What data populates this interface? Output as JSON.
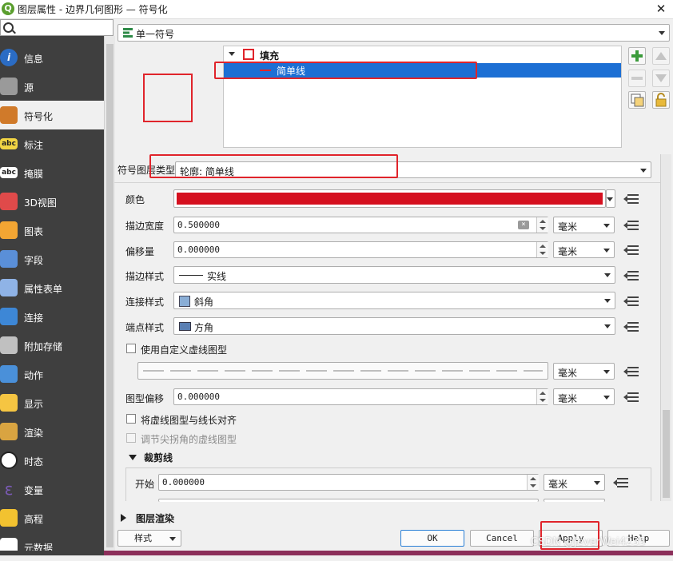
{
  "window": {
    "title": "图层属性 - 边界几何图形 — 符号化",
    "logo_letter": "Q",
    "close": "✕"
  },
  "sidebar": {
    "search_placeholder": "",
    "items": [
      {
        "label": "信息",
        "icon": "info-icon",
        "color": "#2b6cc4"
      },
      {
        "label": "源",
        "icon": "source-gear-icon",
        "color": "#9a9a9a"
      },
      {
        "label": "符号化",
        "icon": "paintbrush-icon",
        "color": "#d07a2a"
      },
      {
        "label": "标注",
        "icon": "label-abc-icon",
        "color": "#f2d544"
      },
      {
        "label": "掩膜",
        "icon": "mask-abc-icon",
        "color": "#ffffff"
      },
      {
        "label": "3D视图",
        "icon": "cube-3d-icon",
        "color": "#e04a4a"
      },
      {
        "label": "图表",
        "icon": "diagram-bars-icon",
        "color": "#f2a533"
      },
      {
        "label": "字段",
        "icon": "fields-icon",
        "color": "#5a8fd8"
      },
      {
        "label": "属性表单",
        "icon": "attribute-form-icon",
        "color": "#8fb3e6"
      },
      {
        "label": "连接",
        "icon": "join-icon",
        "color": "#3d87d6"
      },
      {
        "label": "附加存储",
        "icon": "storage-icon",
        "color": "#c0c0c0"
      },
      {
        "label": "动作",
        "icon": "action-gear-icon",
        "color": "#4a90d9"
      },
      {
        "label": "显示",
        "icon": "display-bubble-icon",
        "color": "#f5c542"
      },
      {
        "label": "渲染",
        "icon": "rendering-brush-icon",
        "color": "#d9a441"
      },
      {
        "label": "时态",
        "icon": "clock-icon",
        "color": "#ffffff"
      },
      {
        "label": "变量",
        "icon": "variable-epsilon-icon",
        "color": "#7a5ab5"
      },
      {
        "label": "高程",
        "icon": "elevation-icon",
        "color": "#f2c230"
      },
      {
        "label": "元数据",
        "icon": "metadata-icon",
        "color": "#ffffff"
      }
    ],
    "active_index": 2
  },
  "symbol_type": {
    "value": "单一符号",
    "icon": "single-symbol-icon"
  },
  "symbol_tree": {
    "root_label": "填充",
    "child_label": "简单线",
    "child_color": "#e0242b"
  },
  "layer_type": {
    "label": "符号图层类型",
    "value": "轮廓: 简单线"
  },
  "props": {
    "color_label": "颜色",
    "color_value": "#d5101f",
    "stroke_width_label": "描边宽度",
    "stroke_width_value": "0.500000",
    "offset_label": "偏移量",
    "offset_value": "0.000000",
    "stroke_style_label": "描边样式",
    "stroke_style_value": "实线",
    "join_style_label": "连接样式",
    "join_style_value": "斜角",
    "cap_style_label": "端点样式",
    "cap_style_value": "方角",
    "custom_dash_label": "使用自定义虚线图型",
    "pattern_offset_label": "图型偏移",
    "pattern_offset_value": "0.000000",
    "align_dash_label": "将虚线图型与线长对齐",
    "tweak_dash_label": "调节尖拐角的虚线图型",
    "clip_section_label": "裁剪线",
    "start_label": "开始",
    "start_value": "0.000000",
    "unit": "毫米",
    "layer_render_label": "图层渲染"
  },
  "buttons": {
    "style": "样式",
    "ok": "OK",
    "cancel": "Cancel",
    "apply": "Apply",
    "help": "Help"
  },
  "watermark": "CSDN @JeverWei4235"
}
